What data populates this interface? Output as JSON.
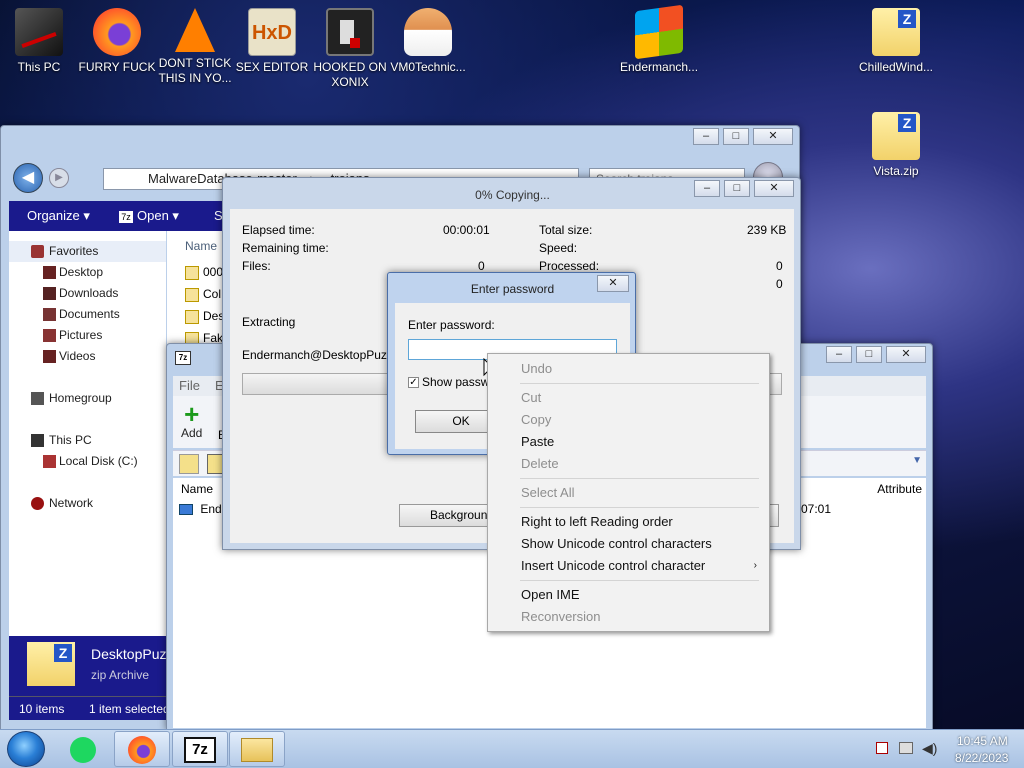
{
  "desktop_icons": [
    {
      "label": "This PC"
    },
    {
      "label": "FURRY FUCK"
    },
    {
      "label": "DONT STICK THIS IN YO..."
    },
    {
      "label": "SEX EDITOR"
    },
    {
      "label": "HOOKED ON XONIX"
    },
    {
      "label": "VM0Technic..."
    },
    {
      "label": "Endermanch..."
    },
    {
      "label": "ChilledWind..."
    },
    {
      "label": "Vista.zip"
    }
  ],
  "explorer": {
    "breadcrumb": [
      "MalwareDatabase-master",
      "trojans"
    ],
    "search_placeholder": "Search trojans",
    "toolbar": {
      "organize": "Organize",
      "open": "Open",
      "share": "Sh"
    },
    "nav": {
      "favorites": "Favorites",
      "desktop": "Desktop",
      "downloads": "Downloads",
      "documents": "Documents",
      "pictures": "Pictures",
      "videos": "Videos",
      "homegroup": "Homegroup",
      "this_pc": "This PC",
      "local_disk": "Local Disk (C:)",
      "network": "Network"
    },
    "column_name": "Name",
    "files": [
      "000",
      "Col",
      "Des",
      "Fak"
    ],
    "details": {
      "name": "DesktopPuz",
      "type": "zip Archive"
    },
    "status": {
      "items": "10 items",
      "selected": "1 item selected"
    }
  },
  "sevenzip": {
    "menu": [
      "File",
      "E"
    ],
    "tools": [
      "Add",
      "E"
    ],
    "col_name": "Name",
    "col_attr": "Attribute",
    "row_name": "Ende",
    "row_time": "07:01"
  },
  "copy_dialog": {
    "title": "0% Copying...",
    "elapsed_label": "Elapsed time:",
    "elapsed_value": "00:00:01",
    "remaining_label": "Remaining time:",
    "files_label": "Files:",
    "files_value": "0",
    "total_label": "Total size:",
    "total_value": "239 KB",
    "speed_label": "Speed:",
    "processed_label": "Processed:",
    "processed_value": "0",
    "compressed_value": "0",
    "extracting": "Extracting",
    "path": "Endermanch@DesktopPuzzle.",
    "background_button": "Background"
  },
  "password_dialog": {
    "title": "Enter password",
    "label": "Enter password:",
    "show_password": "Show password",
    "ok": "OK",
    "input_value": ""
  },
  "context_menu": {
    "undo": "Undo",
    "cut": "Cut",
    "copy": "Copy",
    "paste": "Paste",
    "delete": "Delete",
    "select_all": "Select All",
    "rtl": "Right to left Reading order",
    "show_unicode": "Show Unicode control characters",
    "insert_unicode": "Insert Unicode control character",
    "open_ime": "Open IME",
    "reconversion": "Reconversion"
  },
  "taskbar": {
    "time": "10:45 AM",
    "date": "8/22/2023",
    "app_7z": "7z"
  },
  "colors": {
    "explorer_nav": "#1a1a8c",
    "window_frame": "#bcd0ea",
    "accent": "#3b6fb6"
  }
}
